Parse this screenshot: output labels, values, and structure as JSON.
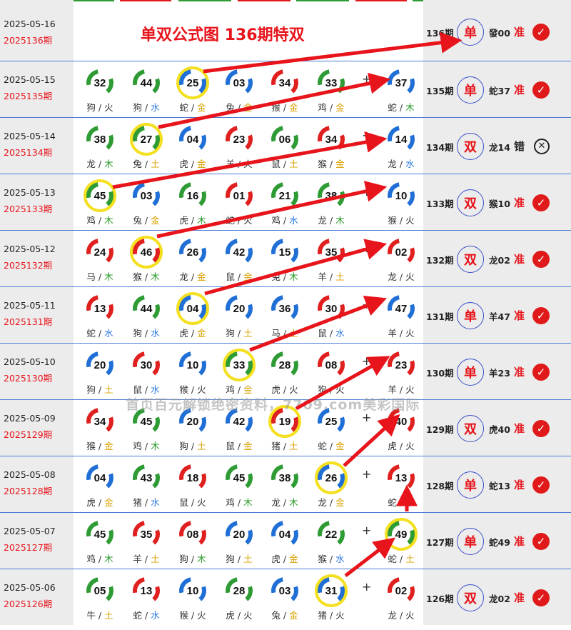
{
  "title": "单双公式图 136期特双",
  "watermark": "首页百元解锁绝密资料，7709.com美彩国际",
  "plus": "+",
  "colors": {
    "accent_red": "#e8141b",
    "check_red": "#e01a1a",
    "row_border": "#4f7dd6",
    "highlight_ring": "#f4e021",
    "panel_gray": "#ececec"
  },
  "rows": [
    {
      "date": "2025-05-16",
      "period": "2025136期",
      "pred_no": "136期",
      "parity": "单",
      "pick": "發00",
      "result": "准",
      "result_icon": "check-icon",
      "balls": []
    },
    {
      "date": "2025-05-15",
      "period": "2025135期",
      "pred_no": "135期",
      "parity": "单",
      "pick": "蛇37",
      "result": "准",
      "result_icon": "check-icon",
      "balls": [
        {
          "n": "32",
          "c": "green",
          "z": "狗",
          "e": "火"
        },
        {
          "n": "44",
          "c": "green",
          "z": "狗",
          "e": "水"
        },
        {
          "n": "25",
          "c": "blue",
          "z": "蛇",
          "e": "金",
          "hl": true
        },
        {
          "n": "03",
          "c": "blue",
          "z": "兔",
          "e": "金"
        },
        {
          "n": "34",
          "c": "red",
          "z": "猴",
          "e": "金"
        },
        {
          "n": "33",
          "c": "green",
          "z": "鸡",
          "e": "金"
        },
        {
          "n": "37",
          "c": "blue",
          "z": "蛇",
          "e": "木"
        }
      ]
    },
    {
      "date": "2025-05-14",
      "period": "2025134期",
      "pred_no": "134期",
      "parity": "双",
      "pick": "龙14",
      "result": "错",
      "result_icon": "x-icon",
      "balls": [
        {
          "n": "38",
          "c": "green",
          "z": "龙",
          "e": "木"
        },
        {
          "n": "27",
          "c": "green",
          "z": "兔",
          "e": "土",
          "hl": true
        },
        {
          "n": "04",
          "c": "blue",
          "z": "虎",
          "e": "金"
        },
        {
          "n": "23",
          "c": "red",
          "z": "羊",
          "e": "火"
        },
        {
          "n": "06",
          "c": "green",
          "z": "鼠",
          "e": "土"
        },
        {
          "n": "34",
          "c": "red",
          "z": "猴",
          "e": "金"
        },
        {
          "n": "14",
          "c": "blue",
          "z": "龙",
          "e": "水"
        }
      ]
    },
    {
      "date": "2025-05-13",
      "period": "2025133期",
      "pred_no": "133期",
      "parity": "双",
      "pick": "猴10",
      "result": "准",
      "result_icon": "check-icon",
      "balls": [
        {
          "n": "45",
          "c": "green",
          "z": "鸡",
          "e": "木",
          "hl": true
        },
        {
          "n": "03",
          "c": "blue",
          "z": "兔",
          "e": "金"
        },
        {
          "n": "16",
          "c": "green",
          "z": "虎",
          "e": "木"
        },
        {
          "n": "01",
          "c": "red",
          "z": "蛇",
          "e": "火"
        },
        {
          "n": "21",
          "c": "green",
          "z": "鸡",
          "e": "水"
        },
        {
          "n": "38",
          "c": "green",
          "z": "龙",
          "e": "木"
        },
        {
          "n": "10",
          "c": "blue",
          "z": "猴",
          "e": "火"
        }
      ]
    },
    {
      "date": "2025-05-12",
      "period": "2025132期",
      "pred_no": "132期",
      "parity": "双",
      "pick": "龙02",
      "result": "准",
      "result_icon": "check-icon",
      "balls": [
        {
          "n": "24",
          "c": "red",
          "z": "马",
          "e": "木"
        },
        {
          "n": "46",
          "c": "red",
          "z": "猴",
          "e": "木",
          "hl": true
        },
        {
          "n": "26",
          "c": "blue",
          "z": "龙",
          "e": "金"
        },
        {
          "n": "42",
          "c": "blue",
          "z": "鼠",
          "e": "金"
        },
        {
          "n": "15",
          "c": "blue",
          "z": "兔",
          "e": "木"
        },
        {
          "n": "35",
          "c": "red",
          "z": "羊",
          "e": "土"
        },
        {
          "n": "02",
          "c": "red",
          "z": "龙",
          "e": "火"
        }
      ]
    },
    {
      "date": "2025-05-11",
      "period": "2025131期",
      "pred_no": "131期",
      "parity": "单",
      "pick": "羊47",
      "result": "准",
      "result_icon": "check-icon",
      "balls": [
        {
          "n": "13",
          "c": "red",
          "z": "蛇",
          "e": "水"
        },
        {
          "n": "44",
          "c": "green",
          "z": "狗",
          "e": "水"
        },
        {
          "n": "04",
          "c": "blue",
          "z": "虎",
          "e": "金",
          "hl": true
        },
        {
          "n": "20",
          "c": "blue",
          "z": "狗",
          "e": "土"
        },
        {
          "n": "36",
          "c": "blue",
          "z": "马",
          "e": "土"
        },
        {
          "n": "30",
          "c": "red",
          "z": "鼠",
          "e": "水"
        },
        {
          "n": "47",
          "c": "blue",
          "z": "羊",
          "e": "火"
        }
      ]
    },
    {
      "date": "2025-05-10",
      "period": "2025130期",
      "pred_no": "130期",
      "parity": "单",
      "pick": "羊23",
      "result": "准",
      "result_icon": "check-icon",
      "balls": [
        {
          "n": "20",
          "c": "blue",
          "z": "狗",
          "e": "土"
        },
        {
          "n": "30",
          "c": "red",
          "z": "鼠",
          "e": "水"
        },
        {
          "n": "10",
          "c": "blue",
          "z": "猴",
          "e": "火"
        },
        {
          "n": "33",
          "c": "green",
          "z": "鸡",
          "e": "金",
          "hl": true
        },
        {
          "n": "28",
          "c": "green",
          "z": "虎",
          "e": "火"
        },
        {
          "n": "08",
          "c": "red",
          "z": "狗",
          "e": "火"
        },
        {
          "n": "23",
          "c": "red",
          "z": "羊",
          "e": "火"
        }
      ]
    },
    {
      "date": "2025-05-09",
      "period": "2025129期",
      "pred_no": "129期",
      "parity": "双",
      "pick": "虎40",
      "result": "准",
      "result_icon": "check-icon",
      "balls": [
        {
          "n": "34",
          "c": "red",
          "z": "猴",
          "e": "金"
        },
        {
          "n": "45",
          "c": "green",
          "z": "鸡",
          "e": "木"
        },
        {
          "n": "20",
          "c": "blue",
          "z": "狗",
          "e": "土"
        },
        {
          "n": "42",
          "c": "blue",
          "z": "鼠",
          "e": "金"
        },
        {
          "n": "19",
          "c": "red",
          "z": "猪",
          "e": "土",
          "hl": true
        },
        {
          "n": "25",
          "c": "blue",
          "z": "蛇",
          "e": "金"
        },
        {
          "n": "40",
          "c": "red",
          "z": "虎",
          "e": "火"
        }
      ]
    },
    {
      "date": "2025-05-08",
      "period": "2025128期",
      "pred_no": "128期",
      "parity": "单",
      "pick": "蛇13",
      "result": "准",
      "result_icon": "check-icon",
      "balls": [
        {
          "n": "04",
          "c": "blue",
          "z": "虎",
          "e": "金"
        },
        {
          "n": "43",
          "c": "green",
          "z": "猪",
          "e": "水"
        },
        {
          "n": "18",
          "c": "red",
          "z": "鼠",
          "e": "火"
        },
        {
          "n": "45",
          "c": "green",
          "z": "鸡",
          "e": "木"
        },
        {
          "n": "38",
          "c": "green",
          "z": "龙",
          "e": "木"
        },
        {
          "n": "26",
          "c": "blue",
          "z": "龙",
          "e": "金",
          "hl": true
        },
        {
          "n": "13",
          "c": "red",
          "z": "蛇",
          "e": "水"
        }
      ]
    },
    {
      "date": "2025-05-07",
      "period": "2025127期",
      "pred_no": "127期",
      "parity": "单",
      "pick": "蛇49",
      "result": "准",
      "result_icon": "check-icon",
      "balls": [
        {
          "n": "45",
          "c": "green",
          "z": "鸡",
          "e": "木"
        },
        {
          "n": "35",
          "c": "red",
          "z": "羊",
          "e": "土"
        },
        {
          "n": "08",
          "c": "red",
          "z": "狗",
          "e": "木"
        },
        {
          "n": "20",
          "c": "blue",
          "z": "狗",
          "e": "土"
        },
        {
          "n": "04",
          "c": "blue",
          "z": "虎",
          "e": "金"
        },
        {
          "n": "22",
          "c": "green",
          "z": "猴",
          "e": "水"
        },
        {
          "n": "49",
          "c": "green",
          "z": "蛇",
          "e": "土",
          "hl": true
        }
      ]
    },
    {
      "date": "2025-05-06",
      "period": "2025126期",
      "pred_no": "126期",
      "parity": "双",
      "pick": "龙02",
      "result": "准",
      "result_icon": "check-icon",
      "balls": [
        {
          "n": "05",
          "c": "green",
          "z": "牛",
          "e": "土"
        },
        {
          "n": "13",
          "c": "red",
          "z": "蛇",
          "e": "水"
        },
        {
          "n": "10",
          "c": "blue",
          "z": "猴",
          "e": "火"
        },
        {
          "n": "28",
          "c": "green",
          "z": "虎",
          "e": "火"
        },
        {
          "n": "03",
          "c": "blue",
          "z": "兔",
          "e": "金"
        },
        {
          "n": "31",
          "c": "blue",
          "z": "猪",
          "e": "火",
          "hl": true
        },
        {
          "n": "02",
          "c": "red",
          "z": "龙",
          "e": "火"
        }
      ]
    }
  ]
}
